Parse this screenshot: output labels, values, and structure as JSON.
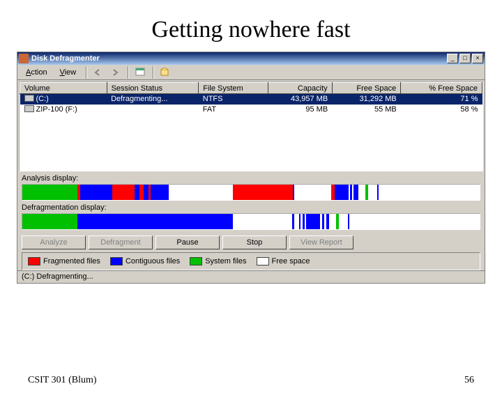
{
  "slide": {
    "title": "Getting nowhere fast",
    "footer_left": "CSIT 301 (Blum)",
    "footer_right": "56"
  },
  "window": {
    "title": "Disk Defragmenter",
    "status": "(C:) Defragmenting..."
  },
  "menu": {
    "action": "Action",
    "view": "View"
  },
  "columns": {
    "volume": "Volume",
    "status": "Session Status",
    "fs": "File System",
    "capacity": "Capacity",
    "free": "Free Space",
    "pct": "% Free Space"
  },
  "rows": [
    {
      "volume": "(C:)",
      "status": "Defragmenting...",
      "fs": "NTFS",
      "capacity": "43,957 MB",
      "free": "31,292 MB",
      "pct": "71 %"
    },
    {
      "volume": "ZIP-100 (F:)",
      "status": "",
      "fs": "FAT",
      "capacity": "95 MB",
      "free": "55 MB",
      "pct": "58 %"
    }
  ],
  "labels": {
    "analysis": "Analysis display:",
    "defrag": "Defragmentation display:"
  },
  "buttons": {
    "analyze": "Analyze",
    "defragment": "Defragment",
    "pause": "Pause",
    "stop": "Stop",
    "report": "View Report"
  },
  "legend": {
    "frag": "Fragmented files",
    "contig": "Contiguous files",
    "sys": "System files",
    "free": "Free space"
  },
  "colors": {
    "frag": "#ff0000",
    "contig": "#0000ff",
    "sys": "#00c000",
    "free": "#ffffff"
  }
}
